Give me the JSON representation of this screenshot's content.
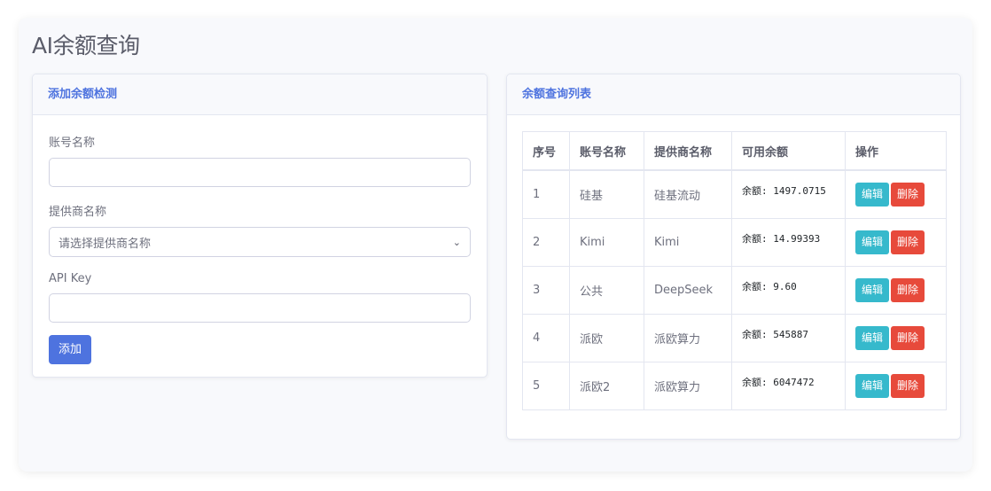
{
  "page": {
    "title": "AI余额查询"
  },
  "add_card": {
    "header": "添加余额检测",
    "account_label": "账号名称",
    "account_value": "",
    "provider_label": "提供商名称",
    "provider_selected": "请选择提供商名称",
    "apikey_label": "API Key",
    "apikey_value": "",
    "submit_label": "添加"
  },
  "list_card": {
    "header": "余额查询列表",
    "columns": [
      "序号",
      "账号名称",
      "提供商名称",
      "可用余额",
      "操作"
    ],
    "rows": [
      {
        "index": "1",
        "account": "硅基",
        "provider": "硅基流动",
        "balance": "余额: 1497.0715",
        "edit": "编辑",
        "delete": "删除"
      },
      {
        "index": "2",
        "account": "Kimi",
        "provider": "Kimi",
        "balance": "余额: 14.99393",
        "edit": "编辑",
        "delete": "删除"
      },
      {
        "index": "3",
        "account": "公共",
        "provider": "DeepSeek",
        "balance": "余额: 9.60",
        "edit": "编辑",
        "delete": "删除"
      },
      {
        "index": "4",
        "account": "派欧",
        "provider": "派欧算力",
        "balance": "余额: 545887",
        "edit": "编辑",
        "delete": "删除"
      },
      {
        "index": "5",
        "account": "派欧2",
        "provider": "派欧算力",
        "balance": "余额: 6047472",
        "edit": "编辑",
        "delete": "删除"
      }
    ]
  },
  "colors": {
    "primary": "#4e73df",
    "info": "#36b9cc",
    "danger": "#e74a3b"
  }
}
